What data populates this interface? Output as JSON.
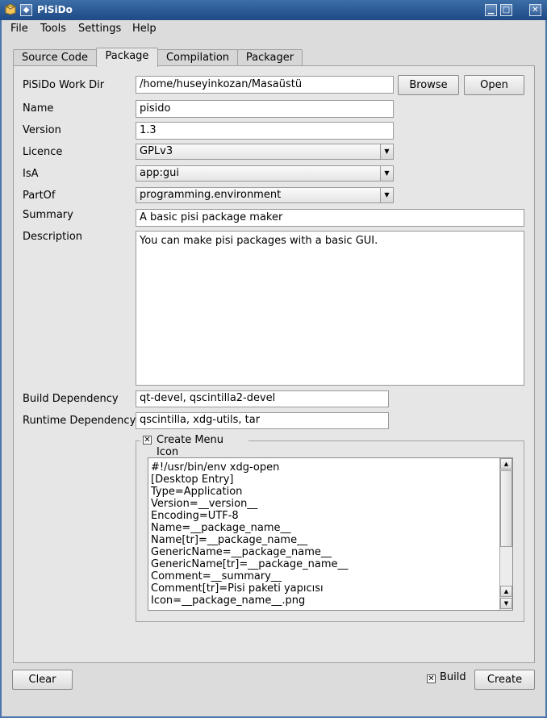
{
  "window": {
    "title": "PiSiDo",
    "minimize": "▁",
    "maximize": "□",
    "close": "✕",
    "icon": "app-icon"
  },
  "menubar": {
    "items": [
      "File",
      "Tools",
      "Settings",
      "Help"
    ]
  },
  "tabs": [
    "Source Code",
    "Package",
    "Compilation",
    "Packager"
  ],
  "active_tab": "Package",
  "form": {
    "workdir": {
      "label": "PiSiDo Work Dir",
      "value": "/home/huseyinkozan/Masaüstü",
      "browse": "Browse",
      "open": "Open"
    },
    "name": {
      "label": "Name",
      "value": "pisido"
    },
    "version": {
      "label": "Version",
      "value": "1.3"
    },
    "licence": {
      "label": "Licence",
      "value": "GPLv3"
    },
    "isa": {
      "label": "IsA",
      "value": "app:gui"
    },
    "partof": {
      "label": "PartOf",
      "value": "programming.environment"
    },
    "summary": {
      "label": "Summary",
      "value": "A basic pisi package maker"
    },
    "description": {
      "label": "Description",
      "value": "You can make pisi packages with a basic GUI."
    },
    "build_dep": {
      "label": "Build Dependency",
      "value": "qt-devel, qscintilla2-devel"
    },
    "runtime_dep": {
      "label": "Runtime Dependency",
      "value": "qscintilla, xdg-utils, tar"
    }
  },
  "menu_icon": {
    "label": "Create Menu Icon",
    "checked": true,
    "lines": [
      "#!/usr/bin/env xdg-open",
      "[Desktop Entry]",
      "Type=Application",
      "Version=__version__",
      "Encoding=UTF-8",
      "Name=__package_name__",
      "Name[tr]=__package_name__",
      "GenericName=__package_name__",
      "GenericName[tr]=__package_name__",
      "Comment=__summary__",
      "Comment[tr]=Pisi paketi yapıcısı",
      "Icon=__package_name__.png"
    ]
  },
  "bottom": {
    "clear": "Clear",
    "build": "Build",
    "build_checked": true,
    "create": "Create"
  }
}
